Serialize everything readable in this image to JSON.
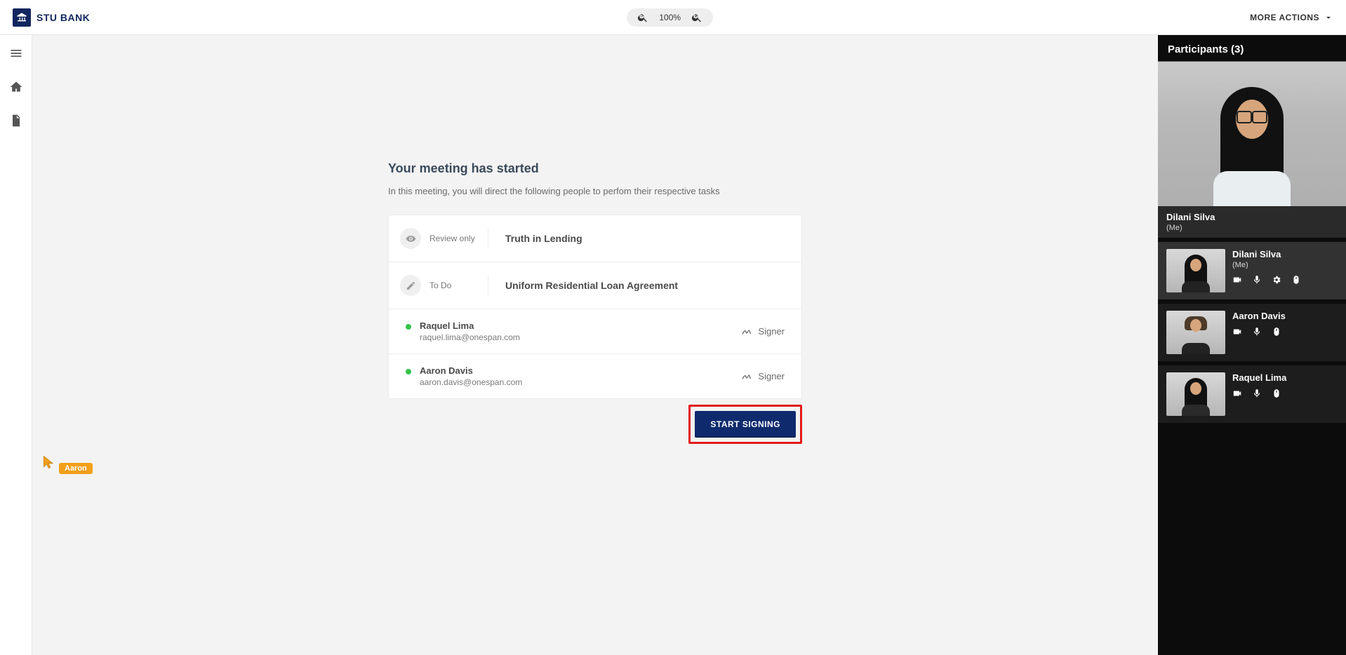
{
  "brand": {
    "name": "STU BANK"
  },
  "zoom": {
    "value": "100%"
  },
  "more_actions_label": "MORE ACTIONS",
  "meeting": {
    "heading": "Your meeting has started",
    "subheading": "In this meeting, you will direct the following people to perfom their respective tasks",
    "tasks": [
      {
        "status": "Review only",
        "title": "Truth in Lending"
      },
      {
        "status": "To Do",
        "title": "Uniform Residential Loan Agreement"
      }
    ],
    "signers": [
      {
        "name": "Raquel Lima",
        "email": "raquel.lima@onespan.com",
        "role": "Signer"
      },
      {
        "name": "Aaron Davis",
        "email": "aaron.davis@onespan.com",
        "role": "Signer"
      }
    ],
    "start_button": "START SIGNING"
  },
  "participants": {
    "header": "Participants (3)",
    "primary": {
      "name": "Dilani Silva",
      "me": "(Me)"
    },
    "self": {
      "name": "Dilani Silva",
      "me": "(Me)"
    },
    "others": [
      {
        "name": "Aaron Davis"
      },
      {
        "name": "Raquel Lima"
      }
    ]
  },
  "remote_cursor": {
    "label": "Aaron"
  }
}
